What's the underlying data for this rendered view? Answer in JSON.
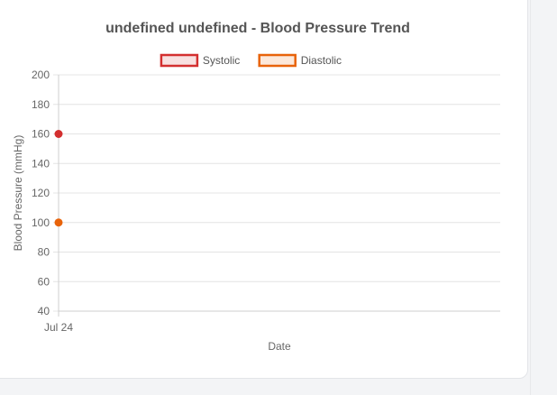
{
  "chart_data": {
    "type": "line",
    "title": "undefined undefined - Blood Pressure Trend",
    "xlabel": "Date",
    "ylabel": "Blood Pressure (mmHg)",
    "categories": [
      "Jul 24"
    ],
    "ylim": [
      40,
      200
    ],
    "yticks": [
      40,
      60,
      80,
      100,
      120,
      140,
      160,
      180,
      200
    ],
    "grid": true,
    "legend_position": "top",
    "series": [
      {
        "name": "Systolic",
        "values": [
          160
        ],
        "color": "#d32f2f"
      },
      {
        "name": "Diastolic",
        "values": [
          100
        ],
        "color": "#e8630a"
      }
    ]
  }
}
